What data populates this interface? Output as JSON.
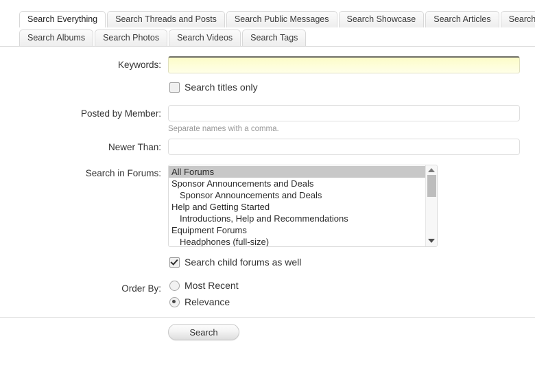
{
  "tabs": {
    "row1": [
      {
        "label": "Search Everything",
        "active": true
      },
      {
        "label": "Search Threads and Posts",
        "active": false
      },
      {
        "label": "Search Public Messages",
        "active": false
      },
      {
        "label": "Search Showcase",
        "active": false
      },
      {
        "label": "Search Articles",
        "active": false
      },
      {
        "label": "Search Conversations",
        "active": false
      }
    ],
    "row2": [
      {
        "label": "Search Albums",
        "active": false
      },
      {
        "label": "Search Photos",
        "active": false
      },
      {
        "label": "Search Videos",
        "active": false
      },
      {
        "label": "Search Tags",
        "active": false
      }
    ]
  },
  "form": {
    "keywords": {
      "label": "Keywords:",
      "value": "",
      "placeholder": ""
    },
    "titles_only": {
      "label": "Search titles only",
      "checked": false
    },
    "posted_by": {
      "label": "Posted by Member:",
      "value": "",
      "placeholder": "",
      "hint": "Separate names with a comma."
    },
    "newer_than": {
      "label": "Newer Than:",
      "value": "",
      "placeholder": ""
    },
    "search_in_forums": {
      "label": "Search in Forums:",
      "options": [
        {
          "text": "All Forums",
          "child": false,
          "selected": true
        },
        {
          "text": "Sponsor Announcements and Deals",
          "child": false,
          "selected": false
        },
        {
          "text": "Sponsor Announcements and Deals",
          "child": true,
          "selected": false
        },
        {
          "text": "Help and Getting Started",
          "child": false,
          "selected": false
        },
        {
          "text": "Introductions, Help and Recommendations",
          "child": true,
          "selected": false
        },
        {
          "text": "Equipment Forums",
          "child": false,
          "selected": false
        },
        {
          "text": "Headphones (full-size)",
          "child": true,
          "selected": false
        }
      ]
    },
    "child_forums": {
      "label": "Search child forums as well",
      "checked": true
    },
    "order_by": {
      "label": "Order By:",
      "options": [
        {
          "label": "Most Recent",
          "selected": false
        },
        {
          "label": "Relevance",
          "selected": true
        }
      ]
    },
    "submit": {
      "label": "Search"
    }
  },
  "colors": {
    "focus_field_bg": "#ffffd6",
    "tab_bg": "#f2f2f2",
    "selected_option_bg": "#c8c8c8",
    "text": "#333333",
    "hint_text": "#999999",
    "border": "#dcdcdc"
  }
}
